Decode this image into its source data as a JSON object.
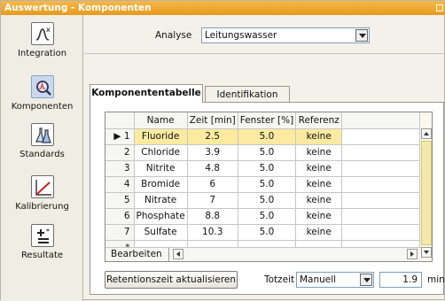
{
  "window": {
    "title": "Auswertung - Komponenten"
  },
  "sidebar": {
    "items": [
      {
        "label": "Integration",
        "icon": "integration-icon"
      },
      {
        "label": "Komponenten",
        "icon": "magnifier-peak-icon",
        "active": true
      },
      {
        "label": "Standards",
        "icon": "flasks-icon"
      },
      {
        "label": "Kalibrierung",
        "icon": "calibration-curve-icon"
      },
      {
        "label": "Resultate",
        "icon": "plus-equals-icon"
      }
    ]
  },
  "analyse": {
    "label": "Analyse",
    "value": "Leitungswasser"
  },
  "tabs": [
    {
      "label": "Komponententabelle",
      "active": true
    },
    {
      "label": "Identifikation",
      "active": false
    }
  ],
  "table": {
    "columns": [
      "Name",
      "Zeit [min]",
      "Fenster [%]",
      "Referenz"
    ],
    "rows": [
      {
        "num": "1",
        "name": "Fluoride",
        "zeit": "2.5",
        "fenster": "5.0",
        "referenz": "keine"
      },
      {
        "num": "2",
        "name": "Chloride",
        "zeit": "3.9",
        "fenster": "5.0",
        "referenz": "keine"
      },
      {
        "num": "3",
        "name": "Nitrite",
        "zeit": "4.8",
        "fenster": "5.0",
        "referenz": "keine"
      },
      {
        "num": "4",
        "name": "Bromide",
        "zeit": "6",
        "fenster": "5.0",
        "referenz": "keine"
      },
      {
        "num": "5",
        "name": "Nitrate",
        "zeit": "7",
        "fenster": "5.0",
        "referenz": "keine"
      },
      {
        "num": "6",
        "name": "Phosphate",
        "zeit": "8.8",
        "fenster": "5.0",
        "referenz": "keine"
      },
      {
        "num": "7",
        "name": "Sulfate",
        "zeit": "10.3",
        "fenster": "5.0",
        "referenz": "keine"
      }
    ],
    "new_row_marker": "*",
    "selected_row_marker": "▶",
    "edit_menu_label": "Bearbeiten ▼"
  },
  "footer": {
    "update_button": "Retentionszeit aktualisieren",
    "totzeit_label": "Totzeit",
    "totzeit_mode": "Manuell",
    "totzeit_value": "1.9",
    "unit": "min"
  },
  "colors": {
    "titlebar": "#f0a030",
    "selected_row": "#fbeaa0",
    "active_nav": "#c9d8ec"
  }
}
